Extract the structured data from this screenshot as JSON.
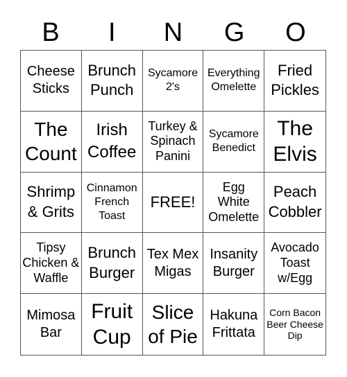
{
  "header": {
    "letters": [
      "B",
      "I",
      "N",
      "G",
      "O"
    ]
  },
  "cells": [
    "Cheese Sticks",
    "Brunch Punch",
    "Sycamore 2's",
    "Everything Omelette",
    "Fried Pickles",
    "The Count",
    "Irish Coffee",
    "Turkey & Spinach Panini",
    "Sycamore Benedict",
    "The Elvis",
    "Shrimp & Grits",
    "Cinnamon French Toast",
    "FREE!",
    "Egg White Omelette",
    "Peach Cobbler",
    "Tipsy Chicken & Waffle",
    "Brunch Burger",
    "Tex Mex Migas",
    "Insanity Burger",
    "Avocado Toast w/Egg",
    "Mimosa Bar",
    "Fruit Cup",
    "Slice of Pie",
    "Hakuna Frittata",
    "Corn Bacon Beer Cheese Dip"
  ]
}
